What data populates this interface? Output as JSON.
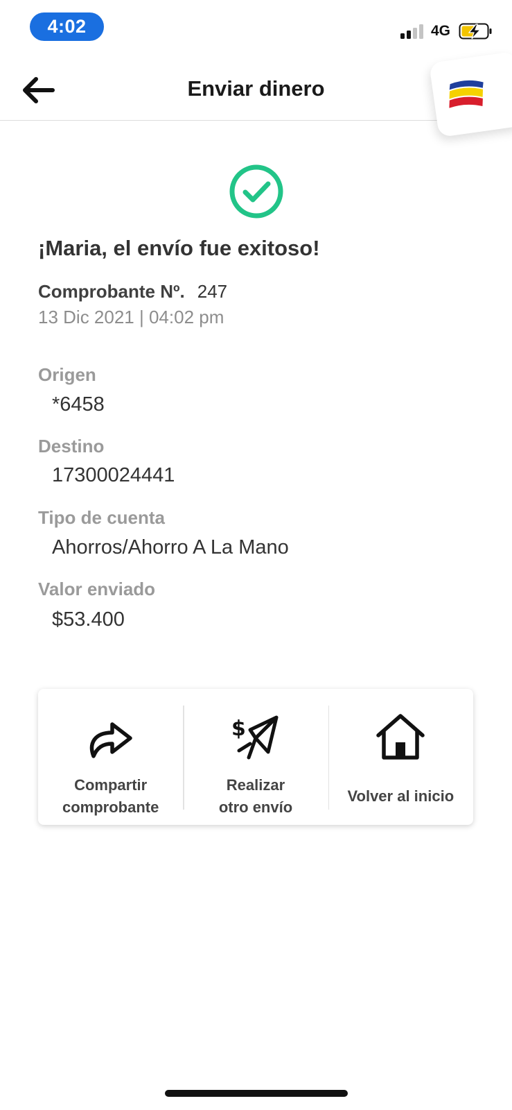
{
  "status_bar": {
    "time": "4:02",
    "network": "4G"
  },
  "header": {
    "title": "Enviar dinero"
  },
  "confirmation": {
    "message": "¡Maria, el envío fue exitoso!",
    "voucher_label": "Comprobante Nº.",
    "voucher_number": "247",
    "datetime": "13 Dic 2021 | 04:02 pm"
  },
  "details": {
    "origin_label": "Origen",
    "origin_value": "*6458",
    "destination_label": "Destino",
    "destination_value": "17300024441",
    "account_type_label": "Tipo de cuenta",
    "account_type_value": "Ahorros/Ahorro A La Mano",
    "amount_label": "Valor enviado",
    "amount_value": "$53.400"
  },
  "actions": {
    "share_line1": "Compartir",
    "share_line2": "comprobante",
    "another_line1": "Realizar",
    "another_line2": "otro envío",
    "home": "Volver al inicio"
  },
  "colors": {
    "accent_blue": "#1a6fe0",
    "success_green": "#22c488",
    "brand_blue": "#1f3f9c",
    "brand_yellow": "#f5d100",
    "brand_red": "#d81e2c"
  },
  "icons": {
    "back": "arrow-left-icon",
    "success": "check-circle-icon",
    "share": "share-arrow-icon",
    "send": "paper-plane-dollar-icon",
    "home": "home-icon",
    "signal": "signal-icon",
    "battery": "battery-charging-icon"
  }
}
